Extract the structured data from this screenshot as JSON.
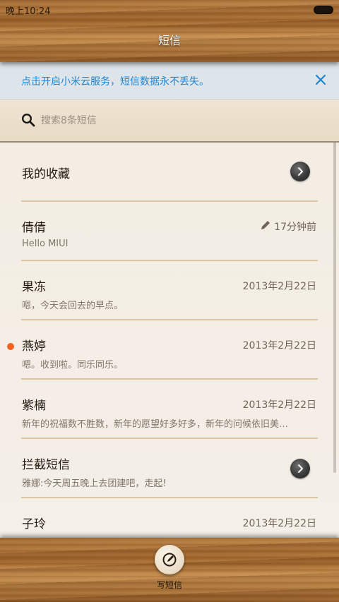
{
  "status_bar": {
    "time": "晚上10:24"
  },
  "header": {
    "title": "短信"
  },
  "banner": {
    "text": "点击开启小米云服务，短信数据永不丢失。"
  },
  "search": {
    "placeholder": "搜索8条短信"
  },
  "conversations": [
    {
      "name": "我的收藏",
      "preview": "",
      "date": "",
      "kind": "folder"
    },
    {
      "name": "倩倩",
      "preview": "Hello MIUI",
      "date": "17分钟前",
      "kind": "draft"
    },
    {
      "name": "果冻",
      "preview": "嗯，今天会回去的早点。",
      "date": "2013年2月22日",
      "kind": "message"
    },
    {
      "name": "燕婷",
      "preview": "嗯。收到啦。同乐同乐。",
      "date": "2013年2月22日",
      "kind": "unread"
    },
    {
      "name": "紫楠",
      "preview": "新年的祝福数不胜数，新年的愿望好多好多，新年的问候依旧美…",
      "date": "2013年2月22日",
      "kind": "message"
    },
    {
      "name": "拦截短信",
      "preview": "雅娜:今天周五晚上去团建吧，走起!",
      "date": "",
      "kind": "folder"
    },
    {
      "name": "子玲",
      "preview": "",
      "date": "2013年2月22日",
      "kind": "message"
    }
  ],
  "footer": {
    "compose_label": "写短信"
  },
  "colors": {
    "accent_blue": "#1f86d1",
    "unread_dot": "#f26322",
    "separator": "#d9c6a8"
  }
}
